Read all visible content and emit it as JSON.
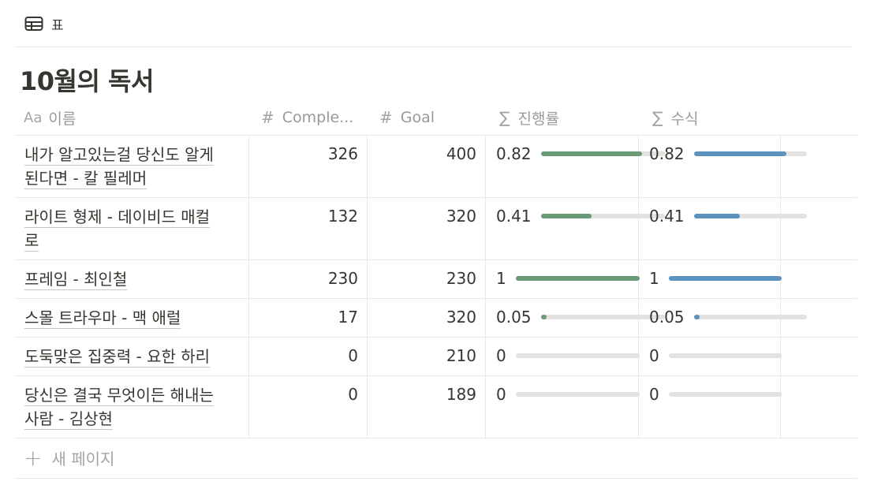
{
  "view": {
    "icon": "table-icon",
    "label": "표"
  },
  "database": {
    "title": "10월의 독서"
  },
  "columns": {
    "name": {
      "icon": "text-type-icon",
      "icon_text": "Aa",
      "label": "이름"
    },
    "completed": {
      "icon": "number-icon",
      "icon_text": "#",
      "label": "Comple..."
    },
    "goal": {
      "icon": "number-icon",
      "icon_text": "#",
      "label": "Goal"
    },
    "progress": {
      "icon": "formula-icon",
      "icon_text": "∑",
      "label": "진행률"
    },
    "formula": {
      "icon": "formula-icon",
      "icon_text": "∑",
      "label": "수식"
    }
  },
  "rows": [
    {
      "title": "내가 알고있는걸 당신도 알게 된다면 - 칼 필레머",
      "title_lines": [
        "내가 알고있는걸 당신도 알게",
        "된다면 - 칼 필레머"
      ],
      "completed": "326",
      "goal": "400",
      "progress_label": "0.82",
      "progress": 0.82,
      "formula_label": "0.82",
      "formula": 0.82
    },
    {
      "title": "라이트 형제 - 데이비드 매컬로",
      "title_lines": [
        "라이트 형제 - 데이비드 매컬",
        "로"
      ],
      "completed": "132",
      "goal": "320",
      "progress_label": "0.41",
      "progress": 0.41,
      "formula_label": "0.41",
      "formula": 0.41
    },
    {
      "title": "프레임  - 최인철",
      "title_lines": [
        "프레임  - 최인철"
      ],
      "completed": "230",
      "goal": "230",
      "progress_label": "1",
      "progress": 1,
      "formula_label": "1",
      "formula": 1
    },
    {
      "title": "스몰 트라우마 - 맥 애럴",
      "title_lines": [
        "스몰 트라우마 - 맥 애럴"
      ],
      "completed": "17",
      "goal": "320",
      "progress_label": "0.05",
      "progress": 0.05,
      "formula_label": "0.05",
      "formula": 0.05
    },
    {
      "title": "도둑맞은 집중력 - 요한 하리",
      "title_lines": [
        "도둑맞은 집중력 - 요한 하리"
      ],
      "completed": "0",
      "goal": "210",
      "progress_label": "0",
      "progress": 0,
      "formula_label": "0",
      "formula": 0
    },
    {
      "title": "당신은 결국 무엇이든 해내는 사람 - 김상현",
      "title_lines": [
        "당신은 결국 무엇이든 해내는",
        "사람 - 김상현"
      ],
      "completed": "0",
      "goal": "189",
      "progress_label": "0",
      "progress": 0,
      "formula_label": "0",
      "formula": 0
    }
  ],
  "new_page": {
    "icon": "plus-icon",
    "label": "새 페이지"
  },
  "colors": {
    "progress_bar": "#6b9a76",
    "formula_bar": "#5b93be",
    "bar_track": "#e3e2e0"
  }
}
